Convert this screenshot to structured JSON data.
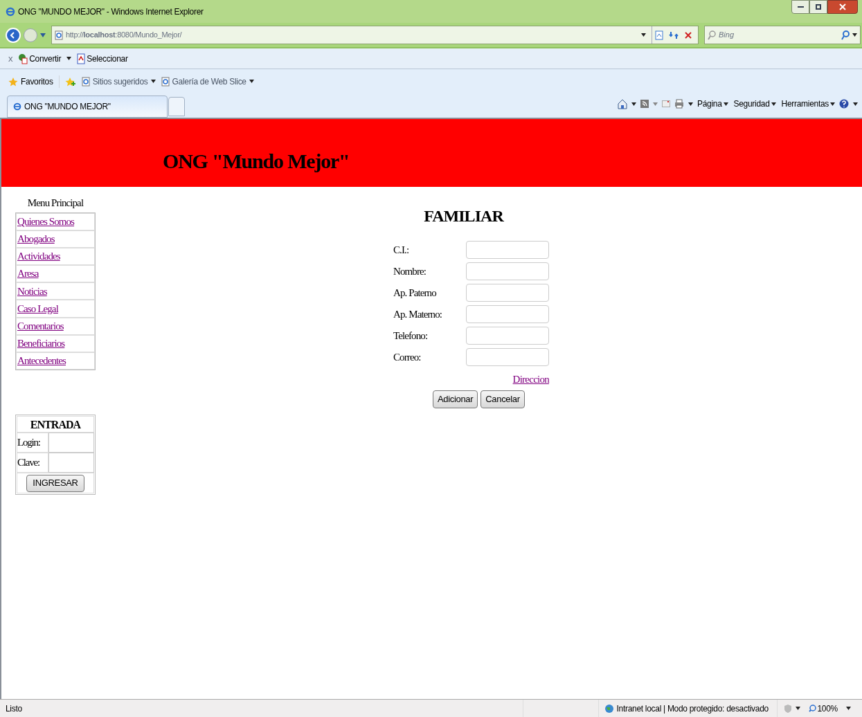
{
  "window": {
    "title": "ONG \"MUNDO MEJOR\" - Windows Internet Explorer"
  },
  "address_bar": {
    "url": "http://**localhost**:8080/Mundo_Mejor/"
  },
  "search": {
    "placeholder": "Bing"
  },
  "command_bar": {
    "close": "x",
    "items": [
      "Convertir",
      "Seleccionar"
    ]
  },
  "favorites_bar": {
    "favorites": "Favoritos",
    "links": [
      "Sitios sugeridos",
      "Galería de Web Slice"
    ]
  },
  "tabs": [
    {
      "label": "ONG \"MUNDO MEJOR\"",
      "selected": true
    }
  ],
  "toolbar_menus": [
    "Página",
    "Seguridad",
    "Herramientas"
  ],
  "page": {
    "header": "ONG \"Mundo Mejor\"",
    "menu_title": "Menu Principal",
    "menu": [
      "Quienes Somos",
      "Abogados",
      "Actividades",
      "Aresa",
      "Noticias",
      "Caso Legal",
      "Comentarios",
      "Beneficiarios",
      "Antecedentes"
    ],
    "login": {
      "title": "ENTRADA",
      "fields": [
        "Login:",
        "Clave:"
      ],
      "button": "INGRESAR"
    },
    "form": {
      "title": "FAMILIAR",
      "fields": [
        "C.I.:",
        "Nombre:",
        "Ap. Paterno",
        "Ap. Materno:",
        "Telefono:",
        "Correo:"
      ],
      "link": "Direccion",
      "buttons": [
        "Adicionar",
        "Cancelar"
      ]
    }
  },
  "status_bar": {
    "text": "Listo",
    "zone": "Intranet local | Modo protegido: desactivado",
    "zoom": "100%"
  }
}
